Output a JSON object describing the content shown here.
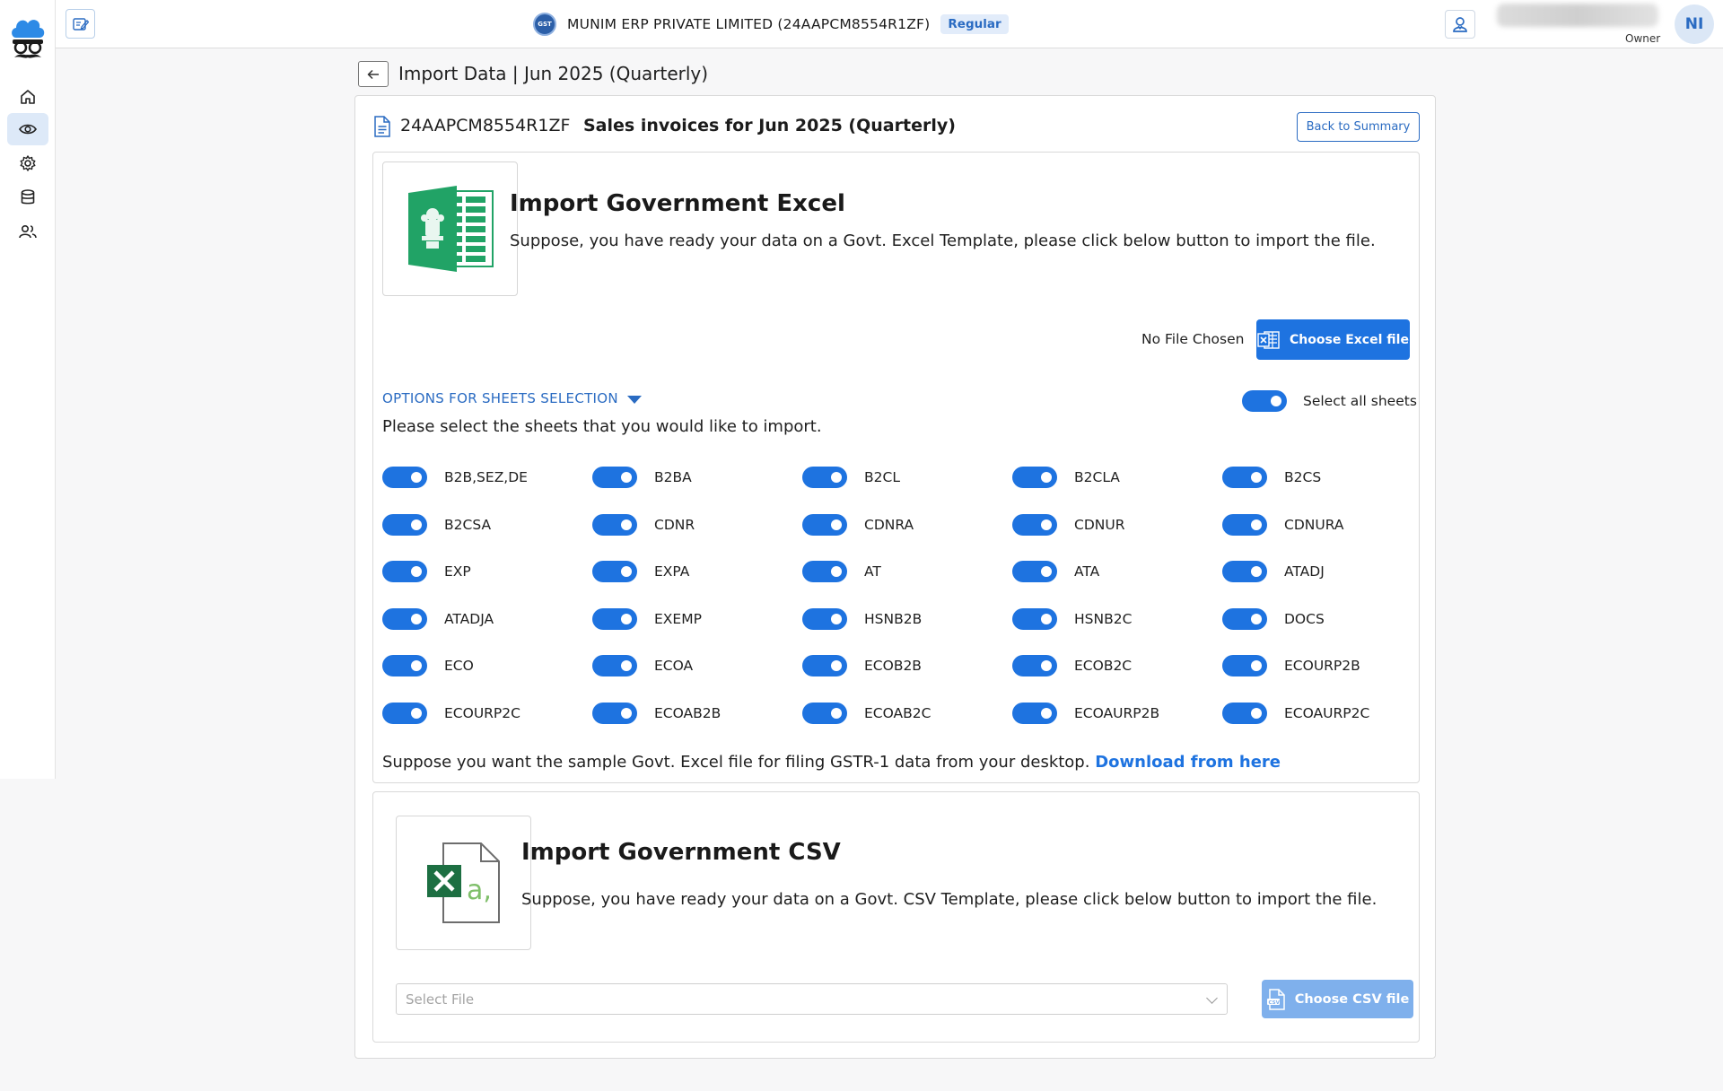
{
  "header": {
    "company_name": "MUNIM ERP PRIVATE LIMITED (24AAPCM8554R1ZF)",
    "gst_badge": "GST",
    "registration_type": "Regular",
    "user_role": "Owner",
    "avatar_initials": "NI"
  },
  "sidebar": {
    "items": [
      {
        "name": "home",
        "icon": "home-icon",
        "active": false
      },
      {
        "name": "view",
        "icon": "eye-icon",
        "active": true
      },
      {
        "name": "settings",
        "icon": "gear-icon",
        "active": false
      },
      {
        "name": "database",
        "icon": "database-icon",
        "active": false
      },
      {
        "name": "users",
        "icon": "users-icon",
        "active": false
      }
    ]
  },
  "page": {
    "title": "Import Data | Jun 2025 (Quarterly)",
    "gstin": "24AAPCM8554R1ZF",
    "subtitle": "Sales invoices for Jun 2025 (Quarterly)",
    "back_to_summary": "Back to Summary"
  },
  "excel": {
    "title": "Import Government Excel",
    "description": "Suppose, you have ready your data on a Govt. Excel Template, please click below button to import the file.",
    "no_file": "No File Chosen",
    "choose_button": "Choose Excel file",
    "options_label": "OPTIONS FOR SHEETS SELECTION",
    "select_all_label": "Select all sheets",
    "select_all_on": true,
    "instruction": "Please select the sheets that you would like to import.",
    "sheets": [
      {
        "label": "B2B,SEZ,DE",
        "on": true
      },
      {
        "label": "B2BA",
        "on": true
      },
      {
        "label": "B2CL",
        "on": true
      },
      {
        "label": "B2CLA",
        "on": true
      },
      {
        "label": "B2CS",
        "on": true
      },
      {
        "label": "B2CSA",
        "on": true
      },
      {
        "label": "CDNR",
        "on": true
      },
      {
        "label": "CDNRA",
        "on": true
      },
      {
        "label": "CDNUR",
        "on": true
      },
      {
        "label": "CDNURA",
        "on": true
      },
      {
        "label": "EXP",
        "on": true
      },
      {
        "label": "EXPA",
        "on": true
      },
      {
        "label": "AT",
        "on": true
      },
      {
        "label": "ATA",
        "on": true
      },
      {
        "label": "ATADJ",
        "on": true
      },
      {
        "label": "ATADJA",
        "on": true
      },
      {
        "label": "EXEMP",
        "on": true
      },
      {
        "label": "HSNB2B",
        "on": true
      },
      {
        "label": "HSNB2C",
        "on": true
      },
      {
        "label": "DOCS",
        "on": true
      },
      {
        "label": "ECO",
        "on": true
      },
      {
        "label": "ECOA",
        "on": true
      },
      {
        "label": "ECOB2B",
        "on": true
      },
      {
        "label": "ECOB2C",
        "on": true
      },
      {
        "label": "ECOURP2B",
        "on": true
      },
      {
        "label": "ECOURP2C",
        "on": true
      },
      {
        "label": "ECOAB2B",
        "on": true
      },
      {
        "label": "ECOAB2C",
        "on": true
      },
      {
        "label": "ECOAURP2B",
        "on": true
      },
      {
        "label": "ECOAURP2C",
        "on": true
      }
    ],
    "sample_text": "Suppose you want the sample Govt. Excel file for filing GSTR-1 data from your desktop.",
    "download_link": "Download from here"
  },
  "csv": {
    "title": "Import Government CSV",
    "description": "Suppose, you have ready your data on a Govt. CSV Template, please click below button to import the file.",
    "select_placeholder": "Select File",
    "choose_button": "Choose CSV file"
  },
  "colors": {
    "primary": "#1e73e0",
    "primary_disabled": "#7fb0ec",
    "excel_green": "#21a366"
  }
}
